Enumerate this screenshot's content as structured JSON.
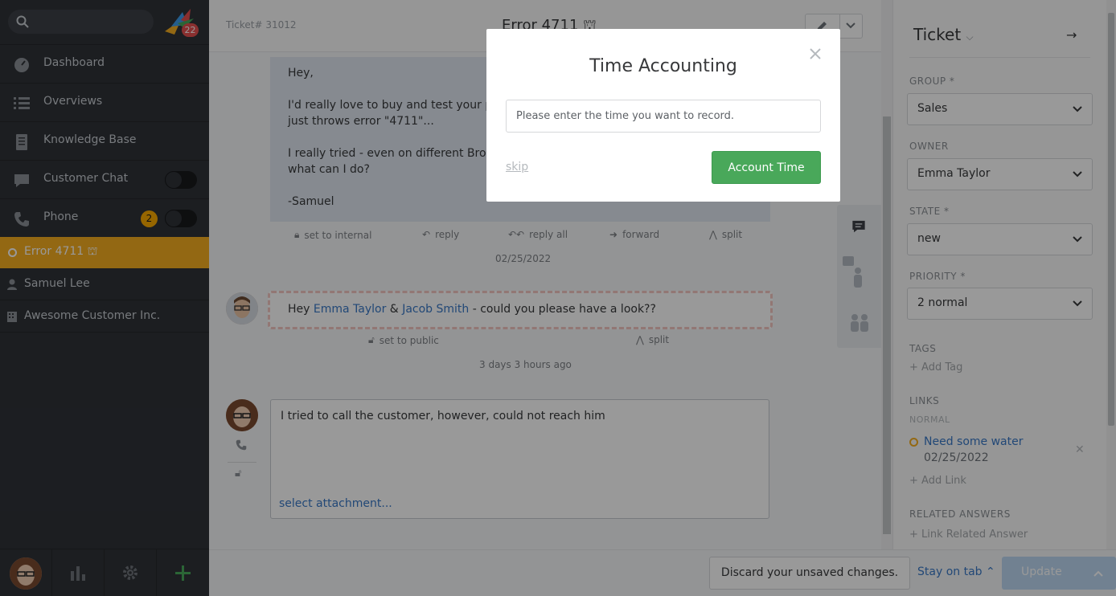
{
  "sidebar": {
    "logo_badge": "22",
    "items": [
      {
        "label": "Dashboard"
      },
      {
        "label": "Overviews"
      },
      {
        "label": "Knowledge Base"
      },
      {
        "label": "Customer Chat"
      },
      {
        "label": "Phone",
        "badge": "2"
      }
    ],
    "active_tab": "Error 4711",
    "sub_items": [
      {
        "label": "Samuel Lee"
      },
      {
        "label": "Awesome Customer Inc."
      }
    ]
  },
  "ticket": {
    "number": "Ticket# 31012",
    "title": "Error 4711"
  },
  "article1": {
    "text": "Hey,\n\nI'd really love to buy and test your product, but it\njust throws error \"4711\"...\n\nI really tried - even on different Browsers\nwhat can I do?\n\n-Samuel",
    "actions": [
      "set to internal",
      "reply",
      "reply all",
      "forward",
      "split"
    ],
    "date": "02/25/2022"
  },
  "note": {
    "prefix": "Hey ",
    "mention1": "Emma Taylor",
    "amp": " & ",
    "mention2": "Jacob Smith",
    "suffix": " - could you please have a look??",
    "actions": [
      "set to public",
      "split"
    ],
    "date": "3 days 3 hours ago"
  },
  "reply": {
    "text": "I tried to call the customer, however, could not reach him",
    "attachment": "select attachment..."
  },
  "panel": {
    "title": "Ticket",
    "group_label": "GROUP *",
    "group_value": "Sales",
    "owner_label": "OWNER",
    "owner_value": "Emma Taylor",
    "state_label": "STATE *",
    "state_value": "new",
    "priority_label": "PRIORITY *",
    "priority_value": "2 normal",
    "tags_label": "TAGS",
    "add_tag": "+ Add Tag",
    "links_label": "LINKS",
    "links_sub": "NORMAL",
    "link_title": "Need some water",
    "link_date": "02/25/2022",
    "add_link": "+ Add Link",
    "related_label": "RELATED ANSWERS",
    "link_related": "+ Link Related Answer"
  },
  "bottom": {
    "discard": "Discard your unsaved changes.",
    "stay": "Stay on tab",
    "update": "Update"
  },
  "modal": {
    "title": "Time Accounting",
    "input_placeholder": "Please enter the time you want to record.",
    "skip": "skip",
    "account_button": "Account Time"
  },
  "colors": {
    "accent": "#f5ae21",
    "primary_button": "#49a85a",
    "link": "#3978c6"
  }
}
